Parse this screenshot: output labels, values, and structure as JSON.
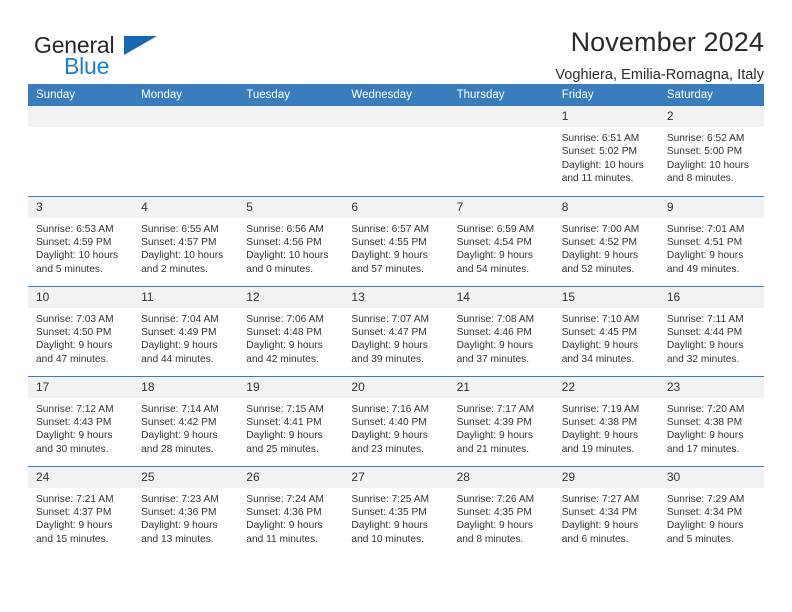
{
  "brand": {
    "name_part1": "General",
    "name_part2": "Blue",
    "flag_icon": "brand-flag-icon"
  },
  "header": {
    "month_title": "November 2024",
    "location": "Voghiera, Emilia-Romagna, Italy"
  },
  "colors": {
    "header_blue": "#3a7dbf",
    "brand_blue": "#1b7fd4",
    "daynum_bg": "#f2f2f2",
    "text": "#333333"
  },
  "weekdays": [
    "Sunday",
    "Monday",
    "Tuesday",
    "Wednesday",
    "Thursday",
    "Friday",
    "Saturday"
  ],
  "weeks": [
    [
      {
        "day": "",
        "empty": true,
        "sunrise": "",
        "sunset": "",
        "daylight1": "",
        "daylight2": ""
      },
      {
        "day": "",
        "empty": true,
        "sunrise": "",
        "sunset": "",
        "daylight1": "",
        "daylight2": ""
      },
      {
        "day": "",
        "empty": true,
        "sunrise": "",
        "sunset": "",
        "daylight1": "",
        "daylight2": ""
      },
      {
        "day": "",
        "empty": true,
        "sunrise": "",
        "sunset": "",
        "daylight1": "",
        "daylight2": ""
      },
      {
        "day": "",
        "empty": true,
        "sunrise": "",
        "sunset": "",
        "daylight1": "",
        "daylight2": ""
      },
      {
        "day": "1",
        "empty": false,
        "sunrise": "Sunrise: 6:51 AM",
        "sunset": "Sunset: 5:02 PM",
        "daylight1": "Daylight: 10 hours",
        "daylight2": "and 11 minutes."
      },
      {
        "day": "2",
        "empty": false,
        "sunrise": "Sunrise: 6:52 AM",
        "sunset": "Sunset: 5:00 PM",
        "daylight1": "Daylight: 10 hours",
        "daylight2": "and 8 minutes."
      }
    ],
    [
      {
        "day": "3",
        "empty": false,
        "sunrise": "Sunrise: 6:53 AM",
        "sunset": "Sunset: 4:59 PM",
        "daylight1": "Daylight: 10 hours",
        "daylight2": "and 5 minutes."
      },
      {
        "day": "4",
        "empty": false,
        "sunrise": "Sunrise: 6:55 AM",
        "sunset": "Sunset: 4:57 PM",
        "daylight1": "Daylight: 10 hours",
        "daylight2": "and 2 minutes."
      },
      {
        "day": "5",
        "empty": false,
        "sunrise": "Sunrise: 6:56 AM",
        "sunset": "Sunset: 4:56 PM",
        "daylight1": "Daylight: 10 hours",
        "daylight2": "and 0 minutes."
      },
      {
        "day": "6",
        "empty": false,
        "sunrise": "Sunrise: 6:57 AM",
        "sunset": "Sunset: 4:55 PM",
        "daylight1": "Daylight: 9 hours",
        "daylight2": "and 57 minutes."
      },
      {
        "day": "7",
        "empty": false,
        "sunrise": "Sunrise: 6:59 AM",
        "sunset": "Sunset: 4:54 PM",
        "daylight1": "Daylight: 9 hours",
        "daylight2": "and 54 minutes."
      },
      {
        "day": "8",
        "empty": false,
        "sunrise": "Sunrise: 7:00 AM",
        "sunset": "Sunset: 4:52 PM",
        "daylight1": "Daylight: 9 hours",
        "daylight2": "and 52 minutes."
      },
      {
        "day": "9",
        "empty": false,
        "sunrise": "Sunrise: 7:01 AM",
        "sunset": "Sunset: 4:51 PM",
        "daylight1": "Daylight: 9 hours",
        "daylight2": "and 49 minutes."
      }
    ],
    [
      {
        "day": "10",
        "empty": false,
        "sunrise": "Sunrise: 7:03 AM",
        "sunset": "Sunset: 4:50 PM",
        "daylight1": "Daylight: 9 hours",
        "daylight2": "and 47 minutes."
      },
      {
        "day": "11",
        "empty": false,
        "sunrise": "Sunrise: 7:04 AM",
        "sunset": "Sunset: 4:49 PM",
        "daylight1": "Daylight: 9 hours",
        "daylight2": "and 44 minutes."
      },
      {
        "day": "12",
        "empty": false,
        "sunrise": "Sunrise: 7:06 AM",
        "sunset": "Sunset: 4:48 PM",
        "daylight1": "Daylight: 9 hours",
        "daylight2": "and 42 minutes."
      },
      {
        "day": "13",
        "empty": false,
        "sunrise": "Sunrise: 7:07 AM",
        "sunset": "Sunset: 4:47 PM",
        "daylight1": "Daylight: 9 hours",
        "daylight2": "and 39 minutes."
      },
      {
        "day": "14",
        "empty": false,
        "sunrise": "Sunrise: 7:08 AM",
        "sunset": "Sunset: 4:46 PM",
        "daylight1": "Daylight: 9 hours",
        "daylight2": "and 37 minutes."
      },
      {
        "day": "15",
        "empty": false,
        "sunrise": "Sunrise: 7:10 AM",
        "sunset": "Sunset: 4:45 PM",
        "daylight1": "Daylight: 9 hours",
        "daylight2": "and 34 minutes."
      },
      {
        "day": "16",
        "empty": false,
        "sunrise": "Sunrise: 7:11 AM",
        "sunset": "Sunset: 4:44 PM",
        "daylight1": "Daylight: 9 hours",
        "daylight2": "and 32 minutes."
      }
    ],
    [
      {
        "day": "17",
        "empty": false,
        "sunrise": "Sunrise: 7:12 AM",
        "sunset": "Sunset: 4:43 PM",
        "daylight1": "Daylight: 9 hours",
        "daylight2": "and 30 minutes."
      },
      {
        "day": "18",
        "empty": false,
        "sunrise": "Sunrise: 7:14 AM",
        "sunset": "Sunset: 4:42 PM",
        "daylight1": "Daylight: 9 hours",
        "daylight2": "and 28 minutes."
      },
      {
        "day": "19",
        "empty": false,
        "sunrise": "Sunrise: 7:15 AM",
        "sunset": "Sunset: 4:41 PM",
        "daylight1": "Daylight: 9 hours",
        "daylight2": "and 25 minutes."
      },
      {
        "day": "20",
        "empty": false,
        "sunrise": "Sunrise: 7:16 AM",
        "sunset": "Sunset: 4:40 PM",
        "daylight1": "Daylight: 9 hours",
        "daylight2": "and 23 minutes."
      },
      {
        "day": "21",
        "empty": false,
        "sunrise": "Sunrise: 7:17 AM",
        "sunset": "Sunset: 4:39 PM",
        "daylight1": "Daylight: 9 hours",
        "daylight2": "and 21 minutes."
      },
      {
        "day": "22",
        "empty": false,
        "sunrise": "Sunrise: 7:19 AM",
        "sunset": "Sunset: 4:38 PM",
        "daylight1": "Daylight: 9 hours",
        "daylight2": "and 19 minutes."
      },
      {
        "day": "23",
        "empty": false,
        "sunrise": "Sunrise: 7:20 AM",
        "sunset": "Sunset: 4:38 PM",
        "daylight1": "Daylight: 9 hours",
        "daylight2": "and 17 minutes."
      }
    ],
    [
      {
        "day": "24",
        "empty": false,
        "sunrise": "Sunrise: 7:21 AM",
        "sunset": "Sunset: 4:37 PM",
        "daylight1": "Daylight: 9 hours",
        "daylight2": "and 15 minutes."
      },
      {
        "day": "25",
        "empty": false,
        "sunrise": "Sunrise: 7:23 AM",
        "sunset": "Sunset: 4:36 PM",
        "daylight1": "Daylight: 9 hours",
        "daylight2": "and 13 minutes."
      },
      {
        "day": "26",
        "empty": false,
        "sunrise": "Sunrise: 7:24 AM",
        "sunset": "Sunset: 4:36 PM",
        "daylight1": "Daylight: 9 hours",
        "daylight2": "and 11 minutes."
      },
      {
        "day": "27",
        "empty": false,
        "sunrise": "Sunrise: 7:25 AM",
        "sunset": "Sunset: 4:35 PM",
        "daylight1": "Daylight: 9 hours",
        "daylight2": "and 10 minutes."
      },
      {
        "day": "28",
        "empty": false,
        "sunrise": "Sunrise: 7:26 AM",
        "sunset": "Sunset: 4:35 PM",
        "daylight1": "Daylight: 9 hours",
        "daylight2": "and 8 minutes."
      },
      {
        "day": "29",
        "empty": false,
        "sunrise": "Sunrise: 7:27 AM",
        "sunset": "Sunset: 4:34 PM",
        "daylight1": "Daylight: 9 hours",
        "daylight2": "and 6 minutes."
      },
      {
        "day": "30",
        "empty": false,
        "sunrise": "Sunrise: 7:29 AM",
        "sunset": "Sunset: 4:34 PM",
        "daylight1": "Daylight: 9 hours",
        "daylight2": "and 5 minutes."
      }
    ]
  ]
}
